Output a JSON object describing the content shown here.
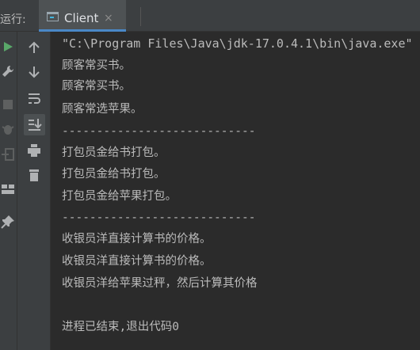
{
  "run_panel": {
    "label": "运行:",
    "tab": {
      "title": "Client",
      "close_glyph": "×",
      "icon": "console-window-icon"
    }
  },
  "left_toolbar": {
    "icons": [
      "run-icon",
      "wrench-icon",
      "stop-icon",
      "bug-icon",
      "exit-icon",
      "layout-icon",
      "pin-icon"
    ]
  },
  "console_toolbar": {
    "icons": [
      "arrow-up-icon",
      "arrow-down-icon",
      "soft-wrap-icon",
      "scroll-to-end-icon",
      "print-icon",
      "trash-icon"
    ]
  },
  "console": {
    "lines": [
      "\"C:\\Program Files\\Java\\jdk-17.0.4.1\\bin\\java.exe\"",
      "顾客常买书。",
      "顾客常买书。",
      "顾客常选苹果。",
      "----------------------------",
      "打包员金给书打包。",
      "打包员金给书打包。",
      "打包员金给苹果打包。",
      "----------------------------",
      "收银员洋直接计算书的价格。",
      "收银员洋直接计算书的价格。",
      "收银员洋给苹果过秤，然后计算其价格",
      "",
      "进程已结束,退出代码0"
    ]
  },
  "colors": {
    "accent": "#4a88c7",
    "run_green": "#59a869",
    "text": "#bbbbbb",
    "background": "#2b2b2b",
    "panel": "#3c3f41"
  }
}
